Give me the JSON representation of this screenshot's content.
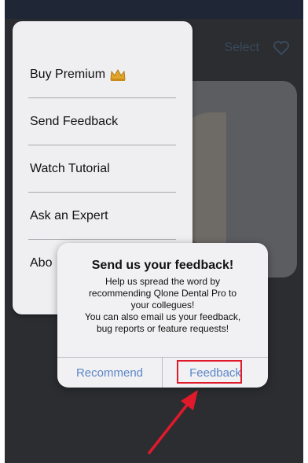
{
  "header": {
    "select_label": "Select"
  },
  "menu": {
    "items": [
      {
        "label": "Buy Premium"
      },
      {
        "label": "Send Feedback"
      },
      {
        "label": "Watch Tutorial"
      },
      {
        "label": "Ask an Expert"
      },
      {
        "label": "Abo"
      }
    ]
  },
  "alert": {
    "title": "Send us your feedback!",
    "body_lines": [
      "Help us spread the word by",
      "recommending Qlone Dental Pro to",
      "your collegues!",
      "You can also email us your feedback,",
      "bug reports or feature requests!"
    ],
    "recommend_label": "Recommend",
    "feedback_label": "Feedback"
  },
  "colors": {
    "accent": "#5b86c7",
    "annotation": "#e0192b"
  },
  "icons": {
    "header_heart": "heart-icon",
    "premium": "crown-icon",
    "annotation": "arrow-icon"
  }
}
